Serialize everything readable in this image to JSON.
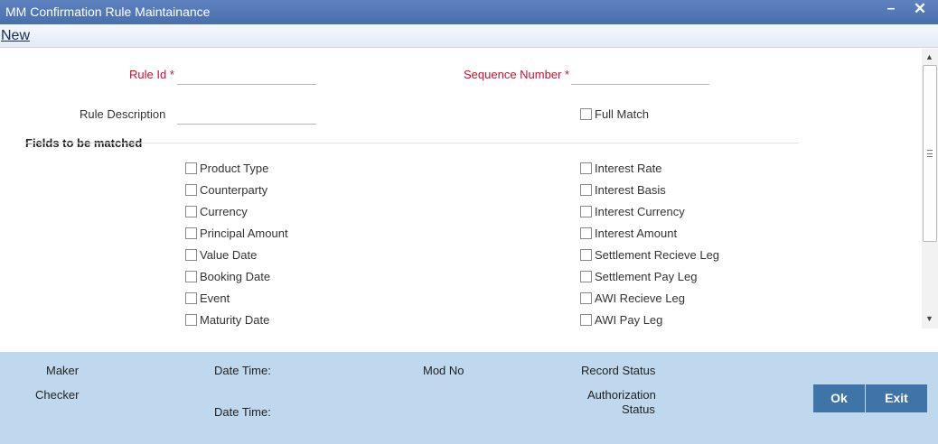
{
  "window": {
    "title": "MM Confirmation Rule Maintainance",
    "minimize_glyph": "–",
    "close_glyph": "✕"
  },
  "menu": {
    "new_label": "New"
  },
  "form": {
    "rule_id_label": "Rule Id",
    "sequence_number_label": "Sequence Number",
    "required_marker": "*",
    "rule_description_label": "Rule Description",
    "rule_id_value": "",
    "sequence_number_value": "",
    "rule_description_value": "",
    "full_match_label": "Full Match",
    "full_match_checked": false
  },
  "fields_section": {
    "title": "Fields to be matched",
    "left": [
      {
        "label": "Product Type",
        "checked": false
      },
      {
        "label": "Counterparty",
        "checked": false
      },
      {
        "label": "Currency",
        "checked": false
      },
      {
        "label": "Principal Amount",
        "checked": false
      },
      {
        "label": "Value Date",
        "checked": false
      },
      {
        "label": "Booking Date",
        "checked": false
      },
      {
        "label": "Event",
        "checked": false
      },
      {
        "label": "Maturity Date",
        "checked": false
      }
    ],
    "right": [
      {
        "label": "Interest Rate",
        "checked": false
      },
      {
        "label": "Interest Basis",
        "checked": false
      },
      {
        "label": "Interest Currency",
        "checked": false
      },
      {
        "label": "Interest Amount",
        "checked": false
      },
      {
        "label": "Settlement Recieve Leg",
        "checked": false
      },
      {
        "label": "Settlement Pay Leg",
        "checked": false
      },
      {
        "label": "AWI Recieve Leg",
        "checked": false
      },
      {
        "label": "AWI Pay Leg",
        "checked": false
      }
    ]
  },
  "footer": {
    "maker_label": "Maker",
    "checker_label": "Checker",
    "date_time_label": "Date Time:",
    "mod_no_label": "Mod No",
    "record_status_label": "Record Status",
    "authorization_label": "Authorization",
    "status_label": "Status",
    "ok_label": "Ok",
    "exit_label": "Exit"
  },
  "colors": {
    "title_bar": "#4a6fad",
    "required_label": "#c8102e",
    "footer_bg": "#bfd8ee",
    "button_bg": "#3f74a8"
  },
  "icons": {
    "scroll_up": "triangle-up-icon",
    "scroll_down": "triangle-down-icon"
  }
}
